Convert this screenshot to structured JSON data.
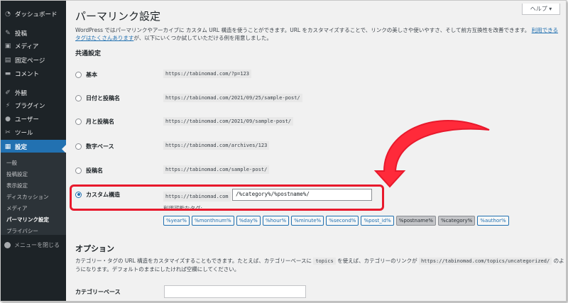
{
  "sidebar": {
    "items": [
      {
        "label": "ダッシュボード",
        "icon": "dashboard-icon"
      },
      {
        "label": "投稿",
        "icon": "pin-icon"
      },
      {
        "label": "メディア",
        "icon": "media-icon"
      },
      {
        "label": "固定ページ",
        "icon": "page-icon"
      },
      {
        "label": "コメント",
        "icon": "comment-icon"
      },
      {
        "label": "外観",
        "icon": "brush-icon"
      },
      {
        "label": "プラグイン",
        "icon": "plugin-icon"
      },
      {
        "label": "ユーザー",
        "icon": "user-icon"
      },
      {
        "label": "ツール",
        "icon": "wrench-icon"
      },
      {
        "label": "設定",
        "icon": "settings-icon"
      }
    ],
    "submenu": [
      "一般",
      "投稿設定",
      "表示設定",
      "ディスカッション",
      "メディア",
      "パーマリンク設定",
      "プライバシー"
    ],
    "collapse_label": "メニューを閉じる"
  },
  "page": {
    "title": "パーマリンク設定",
    "help_label": "ヘルプ ▾",
    "intro_text": "WordPress ではパーマリンクやアーカイブに カスタム URL 構造を使うことができます。URL をカスタマイズすることで、リンクの美しさや使いやすさ、そして前方互換性を改善できます。",
    "intro_link": "利用できるタグはたくさんあります",
    "intro_tail": "が、以下にいくつか試していただける例を用意しました。",
    "common_settings": "共通設定",
    "options": [
      {
        "label": "基本",
        "example": "https://tabinomad.com/?p=123"
      },
      {
        "label": "日付と投稿名",
        "example": "https://tabinomad.com/2021/09/25/sample-post/"
      },
      {
        "label": "月と投稿名",
        "example": "https://tabinomad.com/2021/09/sample-post/"
      },
      {
        "label": "数字ベース",
        "example": "https://tabinomad.com/archives/123"
      },
      {
        "label": "投稿名",
        "example": "https://tabinomad.com/sample-post/"
      }
    ],
    "custom": {
      "label": "カスタム構造",
      "base": "https://tabinomad.com",
      "value": "/%category%/%postname%/",
      "tags_label": "利用可能なタグ:",
      "tags": [
        "%year%",
        "%monthnum%",
        "%day%",
        "%hour%",
        "%minute%",
        "%second%",
        "%post_id%",
        "%postname%",
        "%category%",
        "%author%"
      ]
    },
    "options_title": "オプション",
    "options_desc_1": "カテゴリー・タグの URL 構造をカスタマイズすることもできます。たとえば、カテゴリーベースに",
    "options_code_1": "topics",
    "options_desc_2": "を使えば、カテゴリーのリンクが",
    "options_code_2": "https://tabinomad.com/topics/uncategorized/",
    "options_desc_3": "のようになります。デフォルトのままにしたければ空欄にしてください。",
    "category_base_label": "カテゴリーベース"
  },
  "colors": {
    "sidebar": "#1d2327",
    "accent": "#2271b1",
    "highlight": "#e8192c"
  }
}
